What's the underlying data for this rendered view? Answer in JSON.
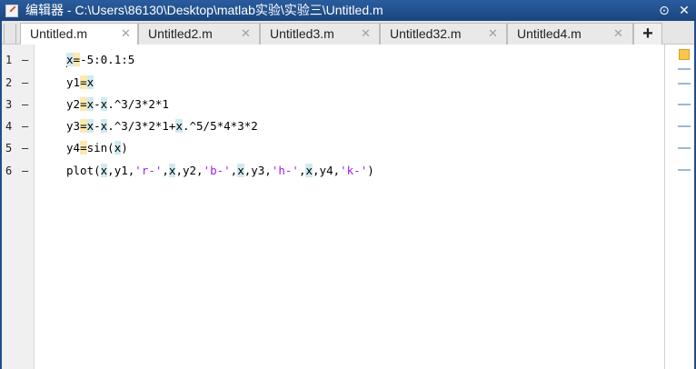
{
  "window": {
    "title": "编辑器 - C:\\Users\\86130\\Desktop\\matlab实验\\实验三\\Untitled.m",
    "minimize_glyph": "⊙",
    "close_glyph": "✕"
  },
  "tabs": [
    {
      "label": "Untitled.m",
      "active": true
    },
    {
      "label": "Untitled2.m",
      "active": false
    },
    {
      "label": "Untitled3.m",
      "active": false
    },
    {
      "label": "Untitled32.m",
      "active": false
    },
    {
      "label": "Untitled4.m",
      "active": false
    }
  ],
  "tab_close_glyph": "✕",
  "add_tab_glyph": "+",
  "editor": {
    "line_numbers": [
      "1",
      "2",
      "3",
      "4",
      "5",
      "6"
    ],
    "line_marker": "–",
    "lines": [
      "x=-5:0.1:5",
      "y1=x",
      "y2=x-x.^3/3*2*1",
      "y3=x-x.^3/3*2*1+x.^5/5*4*3*2",
      "y4=sin(x)",
      "plot(x,y1,'r-',x,y2,'b-',x,y3,'h-',x,y4,'k-')"
    ]
  },
  "colors": {
    "titlebar": "#1f4e8c",
    "string": "#a020f0",
    "highlight_var": "#cfeaf0",
    "highlight_assign": "#fde9b0",
    "overview_warning": "#f7c64b"
  }
}
